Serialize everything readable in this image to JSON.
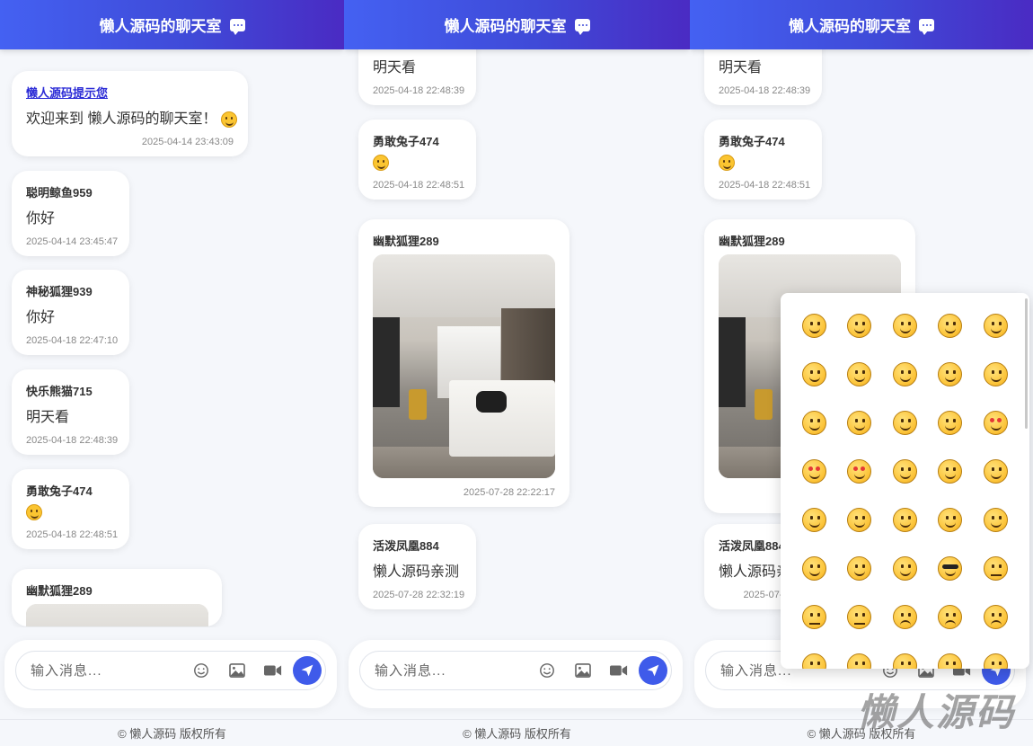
{
  "app": {
    "title": "懒人源码的聊天室",
    "footer": "© 懒人源码 版权所有",
    "watermark": "懒人源码",
    "accent_color": "#3f5bea"
  },
  "input": {
    "placeholder": "输入消息...",
    "icons": [
      "emoji-icon",
      "image-icon",
      "video-icon",
      "send-icon"
    ]
  },
  "panel1": {
    "messages": [
      {
        "sender": "懒人源码提示您",
        "text": "欢迎来到 懒人源码的聊天室！",
        "emoji": "smile",
        "time": "2025-04-14 23:43:09"
      },
      {
        "sender": "聪明鲸鱼959",
        "text": "你好",
        "time": "2025-04-14 23:45:47"
      },
      {
        "sender": "神秘狐狸939",
        "text": "你好",
        "time": "2025-04-18 22:47:10"
      },
      {
        "sender": "快乐熊猫715",
        "text": "明天看",
        "time": "2025-04-18 22:48:39"
      },
      {
        "sender": "勇敢兔子474",
        "text": "",
        "emoji": "sweat-smile",
        "time": "2025-04-18 22:48:51"
      },
      {
        "sender": "幽默狐狸289",
        "text": "",
        "image": "hotel-room-photo",
        "time": ""
      }
    ]
  },
  "panel2": {
    "messages": [
      {
        "sender": "",
        "text": "明天看",
        "time": "2025-04-18 22:48:39"
      },
      {
        "sender": "勇敢兔子474",
        "text": "",
        "emoji": "sweat-smile",
        "time": "2025-04-18 22:48:51"
      },
      {
        "sender": "幽默狐狸289",
        "text": "",
        "image": "hotel-room-photo",
        "time": "2025-07-28 22:22:17"
      },
      {
        "sender": "活泼凤凰884",
        "text": "懒人源码亲测",
        "time": "2025-07-28 22:32:19"
      }
    ]
  },
  "panel3": {
    "messages": [
      {
        "sender": "",
        "text": "明天看",
        "time": "2025-04-18 22:48:39"
      },
      {
        "sender": "勇敢兔子474",
        "text": "",
        "emoji": "sweat-smile",
        "time": "2025-04-18 22:48:51"
      },
      {
        "sender": "幽默狐狸289",
        "text": "",
        "image": "hotel-room-photo",
        "time": ""
      },
      {
        "sender": "活泼凤凰884",
        "text": "懒人源码亲测",
        "time": "2025-07-28 22"
      }
    ],
    "emoji_picker": {
      "emojis": [
        "😀",
        "😃",
        "😄",
        "😁",
        "😆",
        "😅",
        "😂",
        "🤣",
        "😊",
        "😇",
        "🙂",
        "🙃",
        "😉",
        "😌",
        "😍",
        "🥰",
        "😘",
        "😗",
        "😙",
        "😚",
        "😋",
        "😛",
        "😝",
        "😜",
        "🤪",
        "🤨",
        "🧐",
        "🤓",
        "😎",
        "🥸",
        "😏",
        "😒",
        "😞",
        "😔",
        "😟",
        "😕",
        "🙁",
        "☹️",
        "😣",
        "😖"
      ]
    }
  }
}
